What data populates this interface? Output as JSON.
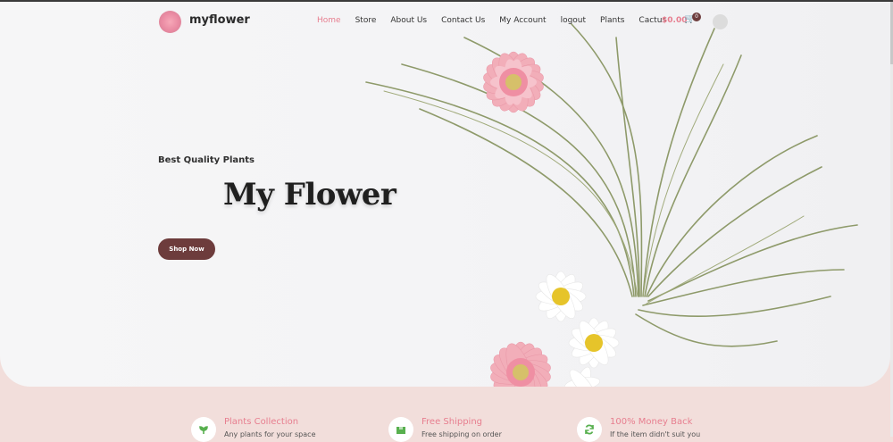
{
  "brand": {
    "name": "myflower"
  },
  "nav": {
    "items": [
      "Home",
      "Store",
      "About Us",
      "Contact Us",
      "My Account",
      "logout",
      "Plants",
      "Cactus"
    ],
    "active": "Home"
  },
  "cart": {
    "price": "$0.00",
    "count": "0"
  },
  "hero": {
    "tagline": "Best Quality Plants",
    "title": "My Flower",
    "button": "Shop Now"
  },
  "features": [
    {
      "icon": "plant-icon",
      "title": "Plants Collection",
      "desc": "Any plants for your space"
    },
    {
      "icon": "box-icon",
      "title": "Free Shipping",
      "desc": "Free shipping on order"
    },
    {
      "icon": "refresh-icon",
      "title": "100% Money Back",
      "desc": "If the item didn't suit you"
    }
  ],
  "colors": {
    "accent": "#e77e8f",
    "button": "#6d3c3c",
    "features_bg": "#f2dedb"
  }
}
